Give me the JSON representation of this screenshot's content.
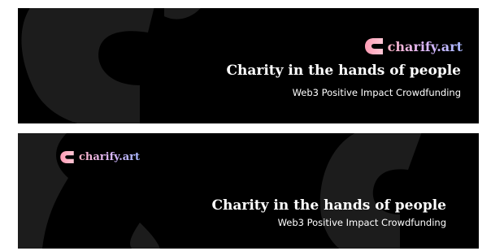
{
  "banners": [
    {
      "logo": {
        "icon": "charify-logo-icon",
        "text": "charify.art"
      },
      "headline": "Charity in the hands of people",
      "subline": "Web3 Positive Impact Crowdfunding"
    },
    {
      "logo": {
        "icon": "charify-logo-icon",
        "text": "charify.art"
      },
      "headline": "Charity in the hands of people",
      "subline": "Web3 Positive Impact Crowdfunding"
    }
  ],
  "colors": {
    "background": "#000000",
    "shape": "#1c1c1c",
    "logo_gradient": [
      "#ffb3c6",
      "#d9b8ff",
      "#a8b8ff"
    ],
    "text": "#ffffff"
  }
}
